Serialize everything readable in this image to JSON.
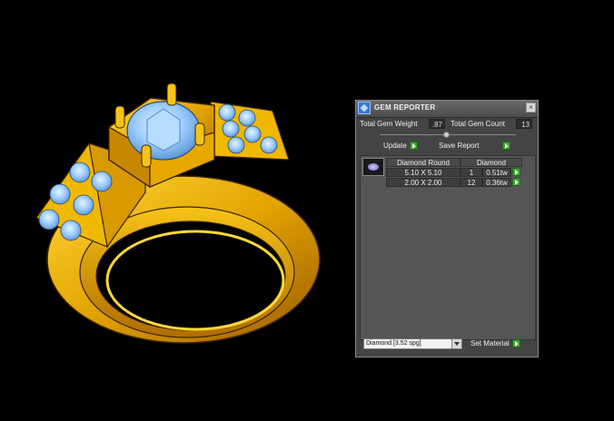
{
  "panel": {
    "title": "GEM REPORTER",
    "close_glyph": "×",
    "total_gem_weight_label": "Total Gem Weight",
    "total_gem_weight_value": ".87",
    "total_gem_count_label": "Total Gem Count",
    "total_gem_count_value": "13",
    "update_label": "Update",
    "save_report_label": "Save Report",
    "table": {
      "headers": [
        "Diamond Round",
        "Diamond"
      ],
      "rows": [
        {
          "size": "5.10 X 5.10",
          "count": "1",
          "weight": "0.51tw"
        },
        {
          "size": "2.00 X 2.00",
          "count": "12",
          "weight": "0.36tw"
        }
      ]
    },
    "material_select": "Diamond     [3.52 spg]",
    "set_material_label": "Set Material"
  },
  "colors": {
    "gold": "#e0a400",
    "gem_blue": "#8ec6ff",
    "panel_bg": "#444446",
    "accent_green": "#3fa532"
  },
  "icons": [
    "gem-reporter-app-icon",
    "close-icon",
    "green-arrow-icon",
    "gem-thumbnail-icon",
    "dropdown-arrow-icon"
  ]
}
